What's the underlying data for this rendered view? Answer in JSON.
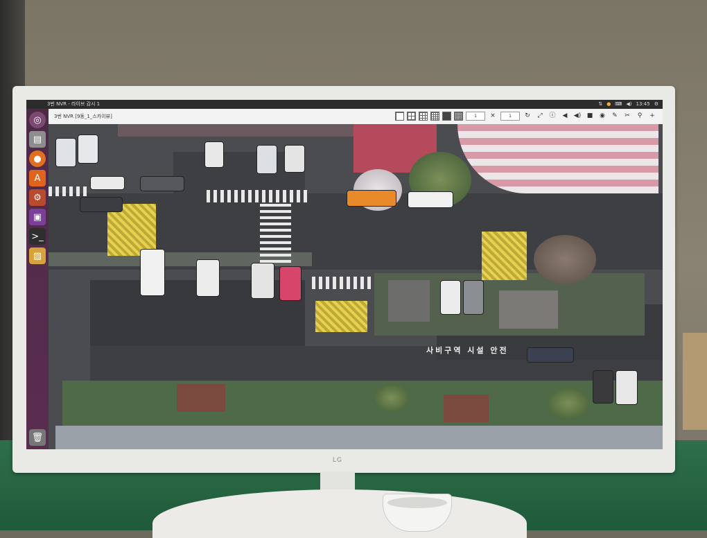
{
  "os": {
    "window_title": "3번 NVR - 라이브 감시 1",
    "clock": "13:45"
  },
  "nvr": {
    "camera_title": "3번 NVR [9동_1_스카이뷰]",
    "layout_field_1": "1",
    "layout_sep": "×",
    "layout_field_2": "1"
  },
  "scene": {
    "road_marking": "사비구역 시설 안전",
    "monitor_brand": "LG"
  },
  "colors": {
    "launcher_bg": "#55294c",
    "os_bar": "#2c2c2c",
    "toolbar_bg": "#f3f3f3"
  },
  "icons": {
    "launcher": [
      "ubuntu-dash-icon",
      "files-icon",
      "firefox-icon",
      "software-center-icon",
      "settings-icon",
      "app-icon",
      "terminal-icon",
      "image-viewer-icon",
      "trash-icon"
    ],
    "toolbar": [
      "layout-1x1-icon",
      "layout-2x2-icon",
      "layout-3x3-icon",
      "layout-4x4-icon",
      "layout-custom-icon",
      "layout-grid-icon",
      "refresh-icon",
      "fullscreen-icon",
      "info-icon",
      "audio-icon",
      "volume-icon",
      "record-icon",
      "snapshot-icon",
      "ptz-icon",
      "settings-icon",
      "zoom-icon",
      "add-icon"
    ]
  }
}
